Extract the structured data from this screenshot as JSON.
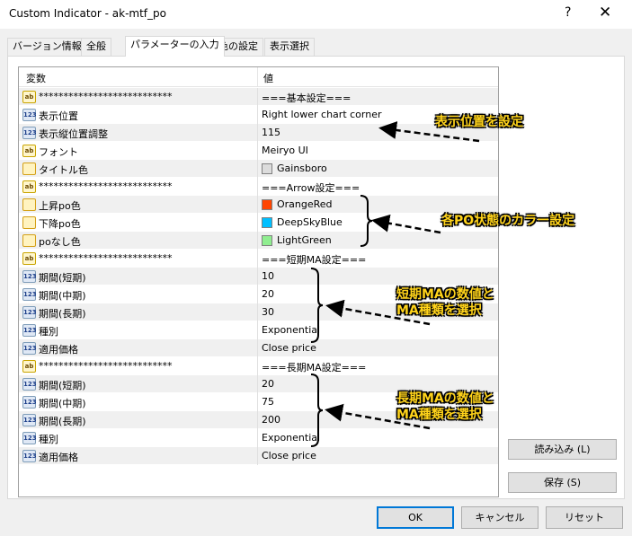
{
  "window": {
    "title": "Custom Indicator - ak-mtf_po",
    "help": "?",
    "close": "✕"
  },
  "tabs": [
    "バージョン情報",
    "全般",
    "パラメーターの入力",
    "色の設定",
    "表示選択"
  ],
  "grid": {
    "col_name": "変数",
    "col_value": "値",
    "rows": [
      {
        "icon": "ab",
        "name": "***************************",
        "value": "===基本設定==="
      },
      {
        "icon": "123",
        "name": "表示位置",
        "value": "Right lower chart corner"
      },
      {
        "icon": "123",
        "name": "表示縦位置調整",
        "value": "115"
      },
      {
        "icon": "ab",
        "name": "フォント",
        "value": "Meiryo UI"
      },
      {
        "icon": "color",
        "name": "タイトル色",
        "value": "Gainsboro",
        "swatch": "#dcdcdc"
      },
      {
        "icon": "ab",
        "name": "***************************",
        "value": "===Arrow設定==="
      },
      {
        "icon": "color",
        "name": "上昇po色",
        "value": "OrangeRed",
        "swatch": "#ff4500"
      },
      {
        "icon": "color",
        "name": "下降po色",
        "value": "DeepSkyBlue",
        "swatch": "#00bfff"
      },
      {
        "icon": "color",
        "name": "poなし色",
        "value": "LightGreen",
        "swatch": "#90ee90"
      },
      {
        "icon": "ab",
        "name": "***************************",
        "value": "===短期MA設定==="
      },
      {
        "icon": "123",
        "name": "期間(短期)",
        "value": "10"
      },
      {
        "icon": "123",
        "name": "期間(中期)",
        "value": "20"
      },
      {
        "icon": "123",
        "name": "期間(長期)",
        "value": "30"
      },
      {
        "icon": "123",
        "name": "種別",
        "value": "Exponential"
      },
      {
        "icon": "123",
        "name": "適用価格",
        "value": "Close price"
      },
      {
        "icon": "ab",
        "name": "***************************",
        "value": "===長期MA設定==="
      },
      {
        "icon": "123",
        "name": "期間(短期)",
        "value": "20"
      },
      {
        "icon": "123",
        "name": "期間(中期)",
        "value": "75"
      },
      {
        "icon": "123",
        "name": "期間(長期)",
        "value": "200"
      },
      {
        "icon": "123",
        "name": "種別",
        "value": "Exponential"
      },
      {
        "icon": "123",
        "name": "適用価格",
        "value": "Close price"
      }
    ]
  },
  "buttons": {
    "load": "読み込み (L)",
    "save": "保存 (S)",
    "ok": "OK",
    "cancel": "キャンセル",
    "reset": "リセット"
  },
  "annotations": {
    "a1": "表示位置を設定",
    "a2": "各PO状態のカラー設定",
    "a3_line1": "短期MAの数値と",
    "a3_line2": "MA種類を選択",
    "a4_line1": "長期MAの数値と",
    "a4_line2": "MA種類を選択"
  },
  "colors": {
    "accent": "#0078d7",
    "annotation_text": "#ffd31a"
  }
}
